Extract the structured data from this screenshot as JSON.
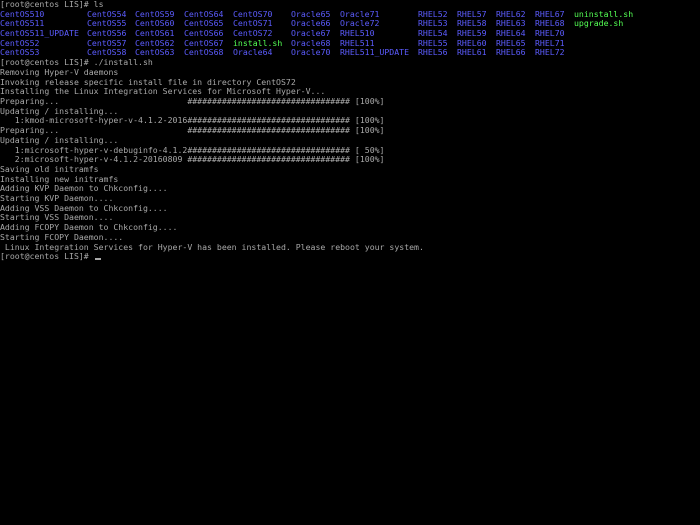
{
  "terminal": {
    "prompt_ls": "[root@centos LIS]# ls",
    "ls_rows": [
      [
        {
          "text": "CentOS510",
          "kind": "dir"
        },
        {
          "text": "CentOS54",
          "kind": "dir"
        },
        {
          "text": "CentOS59",
          "kind": "dir"
        },
        {
          "text": "CentOS64",
          "kind": "dir"
        },
        {
          "text": "CentOS70",
          "kind": "dir"
        },
        {
          "text": "Oracle65",
          "kind": "dir"
        },
        {
          "text": "Oracle71",
          "kind": "dir"
        },
        {
          "text": "RHEL52",
          "kind": "dir"
        },
        {
          "text": "RHEL57",
          "kind": "dir"
        },
        {
          "text": "RHEL62",
          "kind": "dir"
        },
        {
          "text": "RHEL67",
          "kind": "dir"
        },
        {
          "text": "uninstall.sh",
          "kind": "exe"
        }
      ],
      [
        {
          "text": "CentOS511",
          "kind": "dir"
        },
        {
          "text": "CentOS55",
          "kind": "dir"
        },
        {
          "text": "CentOS60",
          "kind": "dir"
        },
        {
          "text": "CentOS65",
          "kind": "dir"
        },
        {
          "text": "CentOS71",
          "kind": "dir"
        },
        {
          "text": "Oracle66",
          "kind": "dir"
        },
        {
          "text": "Oracle72",
          "kind": "dir"
        },
        {
          "text": "RHEL53",
          "kind": "dir"
        },
        {
          "text": "RHEL58",
          "kind": "dir"
        },
        {
          "text": "RHEL63",
          "kind": "dir"
        },
        {
          "text": "RHEL68",
          "kind": "dir"
        },
        {
          "text": "upgrade.sh",
          "kind": "exe"
        }
      ],
      [
        {
          "text": "CentOS511_UPDATE",
          "kind": "dir"
        },
        {
          "text": "CentOS56",
          "kind": "dir"
        },
        {
          "text": "CentOS61",
          "kind": "dir"
        },
        {
          "text": "CentOS66",
          "kind": "dir"
        },
        {
          "text": "CentOS72",
          "kind": "dir"
        },
        {
          "text": "Oracle67",
          "kind": "dir"
        },
        {
          "text": "RHEL510",
          "kind": "dir"
        },
        {
          "text": "RHEL54",
          "kind": "dir"
        },
        {
          "text": "RHEL59",
          "kind": "dir"
        },
        {
          "text": "RHEL64",
          "kind": "dir"
        },
        {
          "text": "RHEL70",
          "kind": "dir"
        }
      ],
      [
        {
          "text": "CentOS52",
          "kind": "dir"
        },
        {
          "text": "CentOS57",
          "kind": "dir"
        },
        {
          "text": "CentOS62",
          "kind": "dir"
        },
        {
          "text": "CentOS67",
          "kind": "dir"
        },
        {
          "text": "install.sh",
          "kind": "exe"
        },
        {
          "text": "Oracle68",
          "kind": "dir"
        },
        {
          "text": "RHEL511",
          "kind": "dir"
        },
        {
          "text": "RHEL55",
          "kind": "dir"
        },
        {
          "text": "RHEL60",
          "kind": "dir"
        },
        {
          "text": "RHEL65",
          "kind": "dir"
        },
        {
          "text": "RHEL71",
          "kind": "dir"
        }
      ],
      [
        {
          "text": "CentOS53",
          "kind": "dir"
        },
        {
          "text": "CentOS58",
          "kind": "dir"
        },
        {
          "text": "CentOS63",
          "kind": "dir"
        },
        {
          "text": "CentOS68",
          "kind": "dir"
        },
        {
          "text": "Oracle64",
          "kind": "dir"
        },
        {
          "text": "Oracle70",
          "kind": "dir"
        },
        {
          "text": "RHEL511_UPDATE",
          "kind": "dir"
        },
        {
          "text": "RHEL56",
          "kind": "dir"
        },
        {
          "text": "RHEL61",
          "kind": "dir"
        },
        {
          "text": "RHEL66",
          "kind": "dir"
        },
        {
          "text": "RHEL72",
          "kind": "dir"
        }
      ]
    ],
    "output_lines": [
      "[root@centos LIS]# ./install.sh",
      "Removing Hyper-V daemons",
      "Invoking release specific install file in directory CentOS72",
      "Installing the Linux Integration Services for Microsoft Hyper-V...",
      "Preparing...                          ################################# [100%]",
      "Updating / installing...",
      "   1:kmod-microsoft-hyper-v-4.1.2-2016################################# [100%]",
      "Preparing...                          ################################# [100%]",
      "Updating / installing...",
      "   1:microsoft-hyper-v-debuginfo-4.1.2################################# [ 50%]",
      "   2:microsoft-hyper-v-4.1.2-20160809 ################################# [100%]",
      "Saving old initramfs",
      "Installing new initramfs",
      "Adding KVP Daemon to Chkconfig....",
      "Starting KVP Daemon....",
      "Adding VSS Daemon to Chkconfig....",
      "Starting VSS Daemon....",
      "Adding FCOPY Daemon to Chkconfig....",
      "Starting FCOPY Daemon....",
      " Linux Integration Services for Hyper-V has been installed. Please reboot your system.",
      "[root@centos LIS]# "
    ],
    "colors": {
      "background": "#000000",
      "text": "#a8a8a8",
      "directory": "#5c5cff",
      "executable": "#54ff54"
    }
  }
}
